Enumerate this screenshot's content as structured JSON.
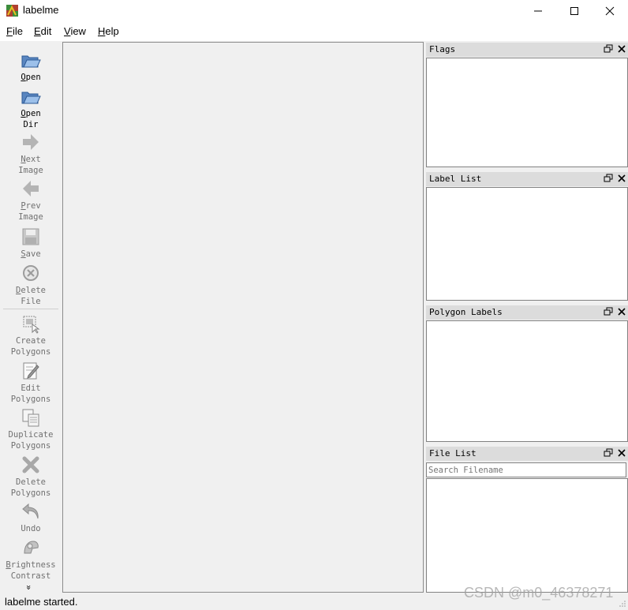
{
  "window": {
    "title": "labelme",
    "controls": [
      "minimize",
      "maximize",
      "close"
    ]
  },
  "menubar": {
    "items": [
      {
        "underline": "F",
        "rest": "ile"
      },
      {
        "underline": "E",
        "rest": "dit"
      },
      {
        "underline": "V",
        "rest": "iew"
      },
      {
        "underline": "H",
        "rest": "elp"
      }
    ]
  },
  "toolbar": {
    "tools": [
      {
        "line1_u": "O",
        "line1": "pen",
        "line2": "",
        "icon": "folder-open-icon",
        "enabled": true
      },
      {
        "line1_u": "O",
        "line1": "pen",
        "line2": "Dir",
        "icon": "folder-open-icon",
        "enabled": true
      },
      {
        "line1_u": "N",
        "line1": "ext",
        "line2": "Image",
        "icon": "arrow-right-icon",
        "enabled": false
      },
      {
        "line1_u": "P",
        "line1": "rev",
        "line2": "Image",
        "icon": "arrow-left-icon",
        "enabled": false
      },
      {
        "line1_u": "S",
        "line1": "ave",
        "line2": "",
        "icon": "save-icon",
        "enabled": false
      },
      {
        "line1_u": "D",
        "line1": "elete",
        "line2": "File",
        "icon": "delete-circle-icon",
        "enabled": false
      },
      {
        "line1_u": "",
        "line1": "Create",
        "line2": "Polygons",
        "icon": "create-polygon-icon",
        "enabled": false
      },
      {
        "line1_u": "",
        "line1": "Edit",
        "line2": "Polygons",
        "icon": "edit-icon",
        "enabled": false
      },
      {
        "line1_u": "",
        "line1": "Duplicate",
        "line2": "Polygons",
        "icon": "duplicate-icon",
        "enabled": false
      },
      {
        "line1_u": "",
        "line1": "Delete",
        "line2": "Polygons",
        "icon": "cross-icon",
        "enabled": false
      },
      {
        "line1_u": "",
        "line1": "Undo",
        "line2": "",
        "icon": "undo-icon",
        "enabled": false
      },
      {
        "line1_u": "B",
        "line1": "rightness",
        "line2": "Contrast",
        "icon": "brightness-icon",
        "enabled": false
      }
    ],
    "more_glyph": "»"
  },
  "docks": {
    "flags": {
      "title": "Flags"
    },
    "label_list": {
      "title": "Label List"
    },
    "polygon_labels": {
      "title": "Polygon Labels"
    },
    "file_list": {
      "title": "File List",
      "search_placeholder": "Search Filename"
    }
  },
  "status": {
    "text": "labelme started."
  },
  "watermark": "CSDN @m0_46378271"
}
